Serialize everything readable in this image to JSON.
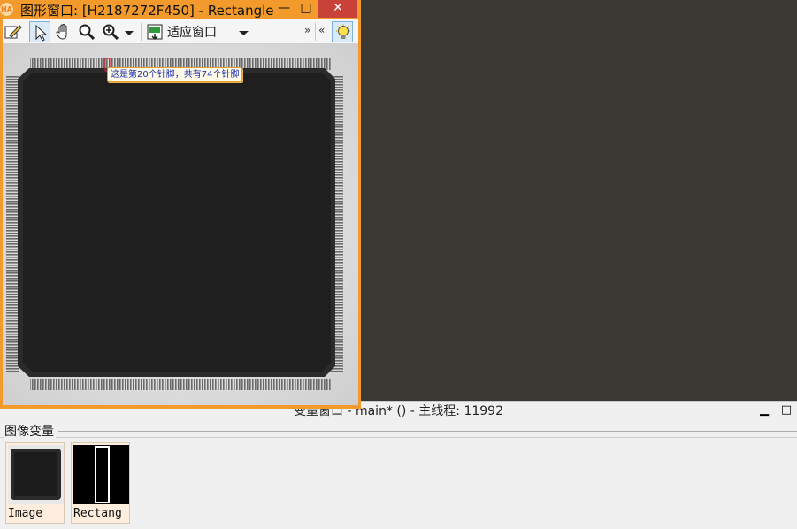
{
  "graphics_window": {
    "title": "图形窗口: [H2187272F450] - Rectangle",
    "app_icon_text": "HA",
    "minimize_glyph": "—",
    "maximize_glyph": "□",
    "close_glyph": "✕",
    "toolbar": {
      "fit_window_label": "适应窗口",
      "overflow_right": "»",
      "overflow_left": "«"
    },
    "tooltip": "这是第20个针脚，共有74个针脚"
  },
  "variable_window": {
    "title": "变量窗口 - main* () - 主线程: 11992",
    "minimize_glyph": "▁",
    "maximize_glyph": "□",
    "section_header": "图像变量",
    "thumbnails": [
      {
        "label": "Image"
      },
      {
        "label": "Rectang"
      }
    ]
  },
  "colors": {
    "titlebar_orange": "#f39a2c",
    "tooltip_text": "#1a2fb0",
    "selection_red": "#e02020",
    "desktop": "#3a3833"
  }
}
